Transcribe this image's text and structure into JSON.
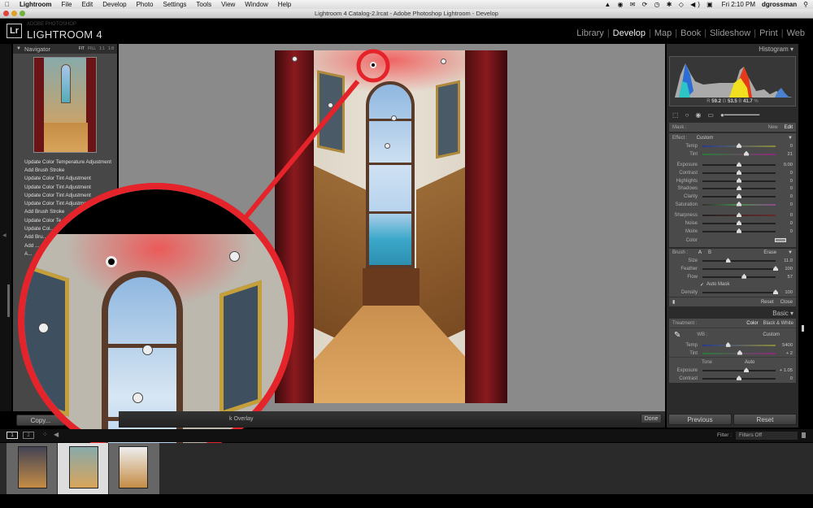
{
  "menubar": {
    "app": "Lightroom",
    "items": [
      "File",
      "Edit",
      "Develop",
      "Photo",
      "Settings",
      "Tools",
      "View",
      "Window",
      "Help"
    ],
    "clock": "Fri 2:10 PM",
    "user": "dgrossman"
  },
  "window": {
    "title": "Lightroom 4 Catalog-2.lrcat - Adobe Photoshop Lightroom - Develop"
  },
  "brand": {
    "logo": "Lr",
    "small": "ADOBE PHOTOSHOP",
    "big": "LIGHTROOM 4"
  },
  "modules": [
    {
      "label": "Library",
      "active": false
    },
    {
      "label": "Develop",
      "active": true
    },
    {
      "label": "Map",
      "active": false
    },
    {
      "label": "Book",
      "active": false
    },
    {
      "label": "Slideshow",
      "active": false
    },
    {
      "label": "Print",
      "active": false
    },
    {
      "label": "Web",
      "active": false
    }
  ],
  "navigator": {
    "title": "Navigator",
    "zoom_options": [
      "FIT",
      "FILL",
      "1:1",
      "1:8"
    ]
  },
  "history": [
    "Update Color Temperature Adjustment",
    "Add Brush Stroke",
    "Update Color Tint Adjustment",
    "Update Color Tint Adjustment",
    "Update Color Tint Adjustment",
    "Update Color Tint Adjustment",
    "Add Brush Stroke",
    "Update Color Te...",
    "Update Col...",
    "Add Bru...",
    "Add ...",
    "A..."
  ],
  "left_bottom": {
    "copy_label": "Copy..."
  },
  "toolbar": {
    "overlay_label": "Show Edit Pins / Mask Overlay",
    "overlay_visible": "k Overlay",
    "done_label": "Done"
  },
  "histogram": {
    "title": "Histogram",
    "r_label": "R",
    "r": "59.2",
    "g_label": "G",
    "g": "53.5",
    "b_label": "B",
    "b": "41.7",
    "unit": "%"
  },
  "mask": {
    "label": "Mask :",
    "new": "New",
    "edit": "Edit"
  },
  "effect": {
    "label": "Effect :",
    "preset": "Custom",
    "sliders": [
      {
        "name": "Temp",
        "value": "0",
        "pos": 0.5
      },
      {
        "name": "Tint",
        "value": "21",
        "pos": 0.6
      },
      {
        "name": "Exposure",
        "value": "0.00",
        "pos": 0.5
      },
      {
        "name": "Contrast",
        "value": "0",
        "pos": 0.5
      },
      {
        "name": "Highlights",
        "value": "0",
        "pos": 0.5
      },
      {
        "name": "Shadows",
        "value": "0",
        "pos": 0.5
      },
      {
        "name": "Clarity",
        "value": "0",
        "pos": 0.5
      },
      {
        "name": "Saturation",
        "value": "0",
        "pos": 0.5
      },
      {
        "name": "Sharpness",
        "value": "0",
        "pos": 0.5
      },
      {
        "name": "Noise",
        "value": "0",
        "pos": 0.5
      },
      {
        "name": "Moire",
        "value": "0",
        "pos": 0.5
      }
    ],
    "color_label": "Color"
  },
  "brush": {
    "label": "Brush :",
    "a": "A",
    "b": "B",
    "erase": "Erase",
    "sliders": [
      {
        "name": "Size",
        "value": "11.0",
        "pos": 0.35
      },
      {
        "name": "Feather",
        "value": "100",
        "pos": 1.0
      },
      {
        "name": "Flow",
        "value": "57",
        "pos": 0.57
      }
    ],
    "auto_mask": "Auto Mask",
    "auto_mask_checked": true,
    "density": {
      "name": "Density",
      "value": "100",
      "pos": 1.0
    },
    "reset": "Reset",
    "close": "Close"
  },
  "basic": {
    "title": "Basic",
    "treatment_label": "Treatment :",
    "color": "Color",
    "bw": "Black & White",
    "wb_label": "WB :",
    "wb_value": "Custom",
    "sliders": [
      {
        "name": "Temp",
        "value": "5400",
        "pos": 0.35
      },
      {
        "name": "Tint",
        "value": "+ 2",
        "pos": 0.51
      }
    ],
    "tone_label": "Tone",
    "auto": "Auto",
    "tone_sliders": [
      {
        "name": "Exposure",
        "value": "+ 1.05",
        "pos": 0.6
      },
      {
        "name": "Contrast",
        "value": "0",
        "pos": 0.5
      }
    ]
  },
  "bottom_buttons": {
    "previous": "Previous",
    "reset": "Reset"
  },
  "filmstrip": {
    "view1": "1",
    "view2": "2",
    "filter_label": "Filter :",
    "filter_value": "Filters Off",
    "thumbs": 3,
    "selected_index": 1
  }
}
